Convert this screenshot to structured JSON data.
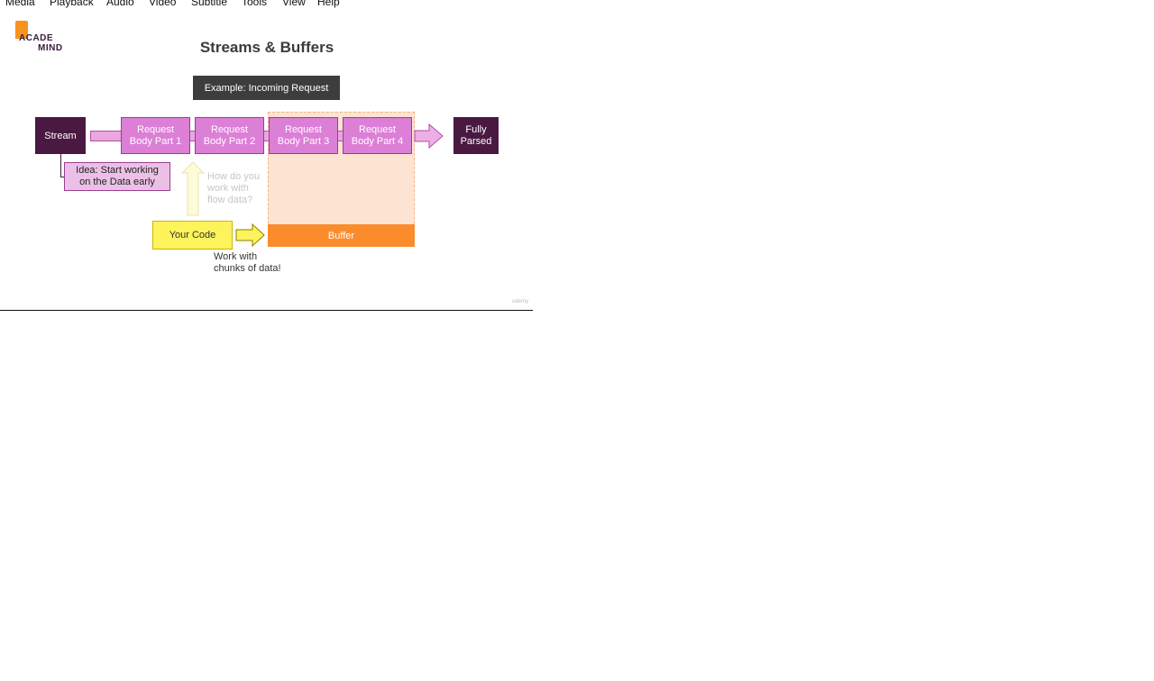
{
  "menubar": {
    "items": [
      "Media",
      "Playback",
      "Audio",
      "Video",
      "Subtitle",
      "Tools",
      "View",
      "Help"
    ]
  },
  "slide": {
    "logo": {
      "line1": "ACADE",
      "line2": "MIND"
    },
    "title": "Streams & Buffers",
    "example_label": "Example: Incoming Request",
    "stream_label": "Stream",
    "parts": [
      "Request\nBody Part 1",
      "Request\nBody Part 2",
      "Request\nBody Part 3",
      "Request\nBody Part 4"
    ],
    "fully_parsed": "Fully\nParsed",
    "idea": "Idea: Start working\non the Data early",
    "question": "How do you\nwork with\nflow data?",
    "your_code": "Your Code",
    "buffer": "Buffer",
    "chunks": "Work with\nchunks of data!",
    "watermark": "udemy"
  },
  "colors": {
    "stream_dark": "#4a1942",
    "part_pink": "#dc7fd6",
    "buffer_orange": "#fb8c2e",
    "buffer_region": "#fde4d2",
    "code_yellow": "#fdf35b",
    "logo_orange": "#f7931e"
  }
}
